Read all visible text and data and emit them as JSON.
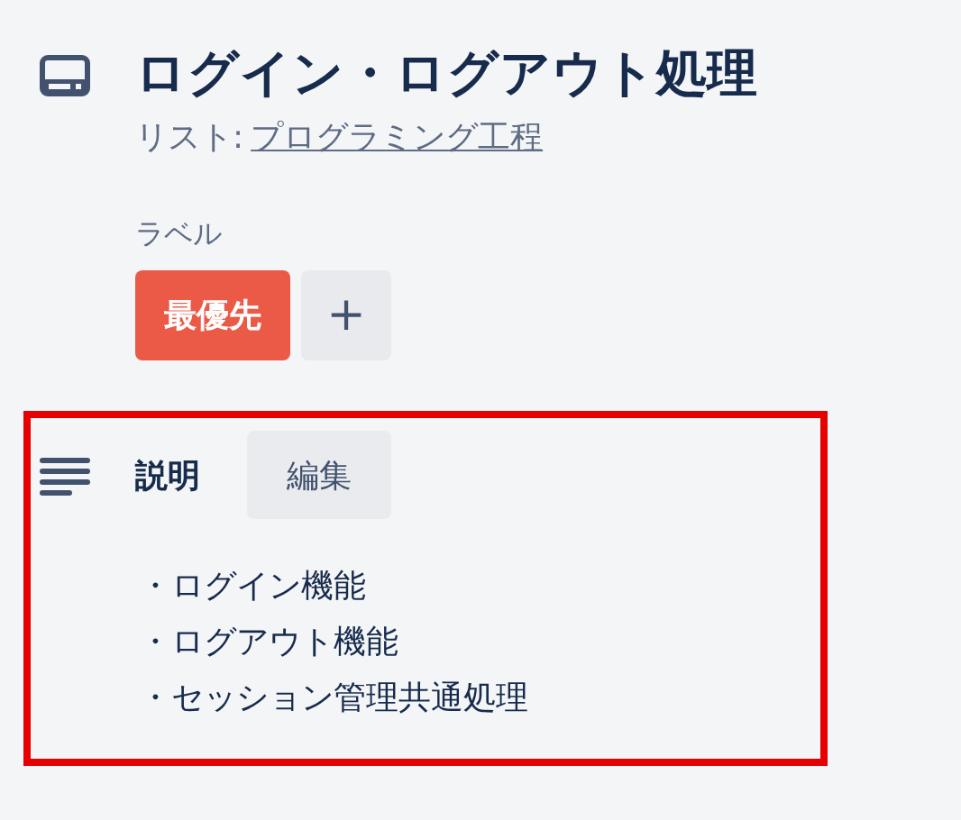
{
  "card": {
    "title": "ログイン・ログアウト処理",
    "list_prefix": "リスト:",
    "list_name": "プログラミング工程"
  },
  "labels": {
    "heading": "ラベル",
    "items": [
      {
        "text": "最優先",
        "color": "#eb5a46"
      }
    ],
    "add_button": "+"
  },
  "description": {
    "heading": "説明",
    "edit_button": "編集",
    "lines": [
      "・ログイン機能",
      "・ログアウト機能",
      "・セッション管理共通処理"
    ]
  }
}
